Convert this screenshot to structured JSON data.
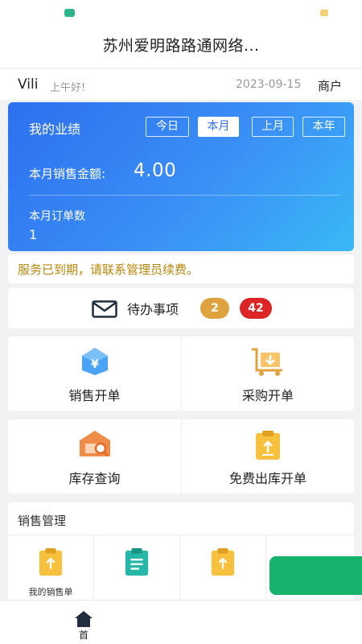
{
  "header": {
    "title": "苏州爱明路路通网络..."
  },
  "user": {
    "name": "Vili",
    "greeting": "上午好!",
    "date": "2023-09-15",
    "type": "商户"
  },
  "performance": {
    "title": "我的业绩",
    "tabs": [
      {
        "label": "今日",
        "active": false
      },
      {
        "label": "本月",
        "active": true
      },
      {
        "label": "上月",
        "active": false
      },
      {
        "label": "本年",
        "active": false
      }
    ],
    "sales_label": "本月销售金额:",
    "sales_value": "4.00",
    "orders_label": "本月订单数",
    "orders_value": "1"
  },
  "notice": {
    "text": "服务已到期，请联系管理员续费。"
  },
  "todo": {
    "label": "待办事项",
    "count_orange": "2",
    "count_red": "42"
  },
  "quick_actions": [
    {
      "label": "销售开单",
      "icon": "yuan-upload-icon"
    },
    {
      "label": "采购开单",
      "icon": "cart-download-icon"
    },
    {
      "label": "库存查询",
      "icon": "warehouse-search-icon"
    },
    {
      "label": "免费出库开单",
      "icon": "clipboard-upload-icon"
    }
  ],
  "sales_management": {
    "title": "销售管理",
    "items": [
      {
        "label": "我的销售单",
        "icon": "clipboard-upload-icon"
      },
      {
        "label": "",
        "icon": "clipboard-list-icon"
      },
      {
        "label": "",
        "icon": "clipboard-upload-icon"
      }
    ]
  },
  "bottom_nav": {
    "home_label": "首"
  },
  "colors": {
    "primary_blue": "#2d6ff0",
    "notice_gold": "#b8860b",
    "badge_orange": "#dea23f",
    "badge_red": "#dc2626",
    "green": "#15b26b"
  }
}
